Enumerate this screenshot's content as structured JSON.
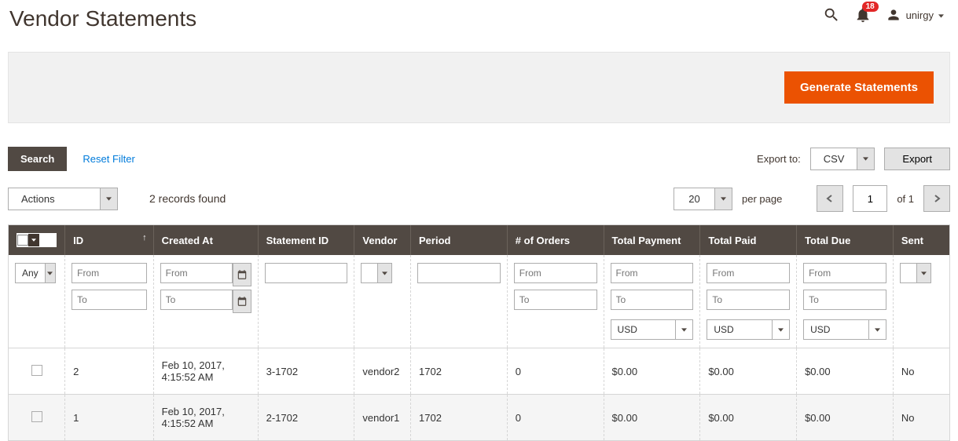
{
  "header": {
    "page_title": "Vendor Statements",
    "notification_count": "18",
    "username": "unirgy"
  },
  "actions": {
    "generate_button": "Generate Statements",
    "search_button": "Search",
    "reset_filter": "Reset Filter",
    "actions_select": "Actions",
    "export_label": "Export to:",
    "export_format": "CSV",
    "export_button": "Export",
    "records_found": "2 records found",
    "per_page_value": "20",
    "per_page_label": "per page",
    "page_current": "1",
    "page_total_label": "of 1"
  },
  "columns": {
    "id": "ID",
    "created_at": "Created At",
    "statement_id": "Statement ID",
    "vendor": "Vendor",
    "period": "Period",
    "num_orders": "# of Orders",
    "total_payment": "Total Payment",
    "total_paid": "Total Paid",
    "total_due": "Total Due",
    "sent": "Sent"
  },
  "filters": {
    "any": "Any",
    "from": "From",
    "to": "To",
    "currency": "USD"
  },
  "rows": [
    {
      "id": "2",
      "created_at": "Feb 10, 2017, 4:15:52 AM",
      "statement_id": "3-1702",
      "vendor": "vendor2",
      "period": "1702",
      "num_orders": "0",
      "total_payment": "$0.00",
      "total_paid": "$0.00",
      "total_due": "$0.00",
      "sent": "No"
    },
    {
      "id": "1",
      "created_at": "Feb 10, 2017, 4:15:52 AM",
      "statement_id": "2-1702",
      "vendor": "vendor1",
      "period": "1702",
      "num_orders": "0",
      "total_payment": "$0.00",
      "total_paid": "$0.00",
      "total_due": "$0.00",
      "sent": "No"
    }
  ]
}
